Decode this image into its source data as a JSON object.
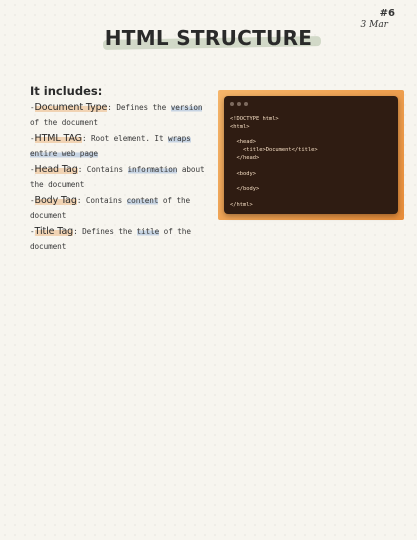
{
  "page": {
    "number": "#6",
    "date": "3 Mar"
  },
  "title": "HTML STRUCTURE",
  "notes": {
    "heading": "It includes:",
    "items": [
      {
        "prefix": "-",
        "term": "Document Type",
        "colon": ": ",
        "pre": "Defines the ",
        "highlight": "version",
        "post": " of the document"
      },
      {
        "prefix": "-",
        "term": "HTML TAG",
        "colon": ": ",
        "pre": "Root element. It ",
        "highlight": "wraps entire web page",
        "post": ""
      },
      {
        "prefix": "-",
        "term": "Head Tag",
        "colon": ": ",
        "pre": "Contains ",
        "highlight": "information",
        "post": " about the document"
      },
      {
        "prefix": "-",
        "term": "Body Tag",
        "colon": ": ",
        "pre": "Contains ",
        "highlight": "content",
        "post": " of the document"
      },
      {
        "prefix": "-",
        "term": "Title Tag",
        "colon": ": ",
        "pre": "Defines the ",
        "highlight": "title",
        "post": " of the document"
      }
    ]
  },
  "code_snippet": {
    "lines": [
      "<!DOCTYPE html>",
      "<html>",
      "",
      "  <head>",
      "    <title>Document</title>",
      "  </head>",
      "",
      "  <body>",
      "",
      "  </body>",
      "",
      "</html>"
    ]
  },
  "colors": {
    "term_highlight": "#f1d3b3",
    "text_highlight": "#c7d4e3",
    "title_highlight": "#b9c7ae",
    "code_frame": "#f0a14f",
    "code_bg": "#2f1c12"
  }
}
